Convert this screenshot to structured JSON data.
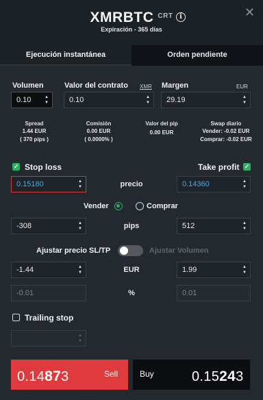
{
  "header": {
    "symbol": "XMRBTC",
    "badge": "CRT",
    "expiry": "Expiración - 365 días"
  },
  "tabs": [
    {
      "label": "Ejecución instantánea",
      "active": true
    },
    {
      "label": "Orden pendiente",
      "active": false
    }
  ],
  "volume": {
    "label": "Volumen",
    "value": "0.10"
  },
  "contract": {
    "label": "Valor del contrato",
    "unit": "XMR",
    "value": "0.10"
  },
  "margin": {
    "label": "Margen",
    "unit": "EUR",
    "value": "29.19"
  },
  "stats": {
    "spread": {
      "label": "Spread",
      "line1": "1.44 EUR",
      "line2": "( 370 pips )"
    },
    "commission": {
      "label": "Comisión",
      "line1": "0.00 EUR",
      "line2": "( 0.0000% )"
    },
    "pip_value": {
      "label": "Valor del pip",
      "line1": "0.00 EUR"
    },
    "swap": {
      "label": "Swap diario",
      "line1": "Vender: -0.02 EUR",
      "line2": "Comprar: -0.02 EUR"
    }
  },
  "stop_loss": {
    "label": "Stop loss",
    "checked": true,
    "price": "0.15180",
    "pips": "-308",
    "eur": "-1.44",
    "percent": "-0.01"
  },
  "take_profit": {
    "label": "Take profit",
    "checked": true,
    "price": "0.14360",
    "pips": "512",
    "eur": "1.99",
    "percent": "0.01"
  },
  "row_labels": {
    "price": "precio",
    "pips": "pips",
    "eur": "EUR",
    "percent": "%"
  },
  "direction": {
    "sell_label": "Vender",
    "buy_label": "Comprar",
    "selected": "Vender"
  },
  "adjust": {
    "price_label": "Ajustar precio SL/TP",
    "volume_label": "Ajustar Volumen",
    "on": false
  },
  "trailing_stop": {
    "label": "Trailing stop",
    "checked": false
  },
  "sell_button": {
    "label": "Sell",
    "price_main": "0.14",
    "price_big": "87",
    "price_pip": "3"
  },
  "buy_button": {
    "label": "Buy",
    "price_main": "0.15",
    "price_big": "24",
    "price_pip": "3"
  },
  "colors": {
    "accent_green": "#2aae60",
    "sell_red": "#e03b3c",
    "blue_value": "#4aa8e0"
  },
  "icons": [
    "info-icon",
    "close-icon",
    "check-icon",
    "chevron-up-icon",
    "chevron-down-icon"
  ]
}
